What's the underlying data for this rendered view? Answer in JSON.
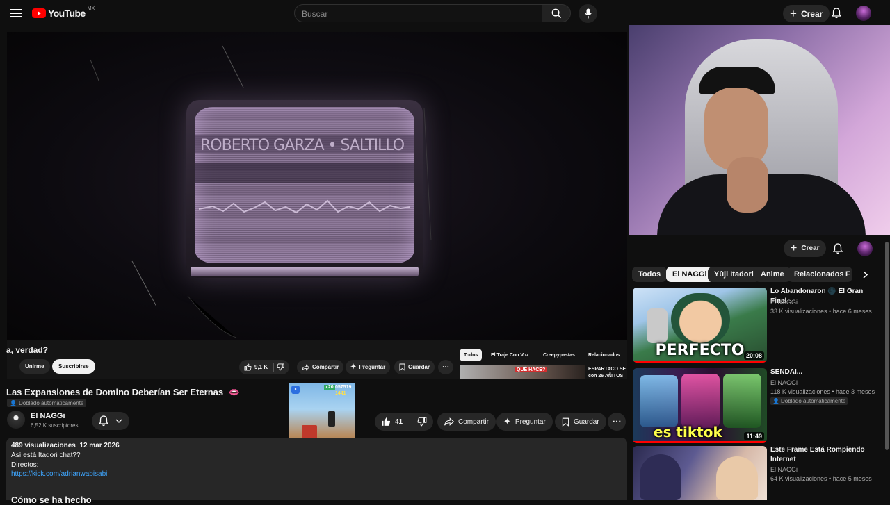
{
  "header": {
    "logo_text": "YouTube",
    "country": "MX",
    "search_placeholder": "Buscar",
    "create_label": "Crear"
  },
  "video_overlay": {
    "partial_title": "a, verdad?",
    "join_label": "Unirme",
    "subscribe_label": "Suscribirse",
    "likes": "9,1 K",
    "share_label": "Compartir",
    "ask_label": "Preguntar",
    "save_label": "Guardar",
    "chips": [
      "Todos",
      "El Traje Con Voz",
      "Creepypastas",
      "Relacionados"
    ],
    "rec_text": "ESPARTACO SE con 26 AÑITOS",
    "rec_thumb_text": "QUÉ HACE?",
    "tv_text": "ROBERTO GARZA • SALTILLO"
  },
  "main": {
    "title": "Las Expansiones de Domino Deberían Ser Eternas",
    "dubbed_label": "Doblado automáticamente",
    "channel": "El NAGGi",
    "subscribers": "6,52 K suscriptores",
    "likes": "41",
    "share_label": "Compartir",
    "ask_label": "Preguntar",
    "save_label": "Guardar",
    "views": "489 visualizaciones",
    "date": "12 mar 2026",
    "desc_line1": "Así está Itadori chat??",
    "desc_line2": "Directos:",
    "desc_link": "https://kick.com/adrianwabisabi",
    "section_heading": "Cómo se ha hecho",
    "game_score": "057519",
    "game_coins": "1441",
    "game_mult": "x20"
  },
  "side": {
    "create_label": "Crear",
    "chips": [
      "Todos",
      "El NAGGi",
      "Yûji Itadori",
      "Anime",
      "Relacionados",
      "F"
    ],
    "videos": [
      {
        "title": "Lo Abandonaron 🌑 El Gran Final",
        "channel": "El NAGGi",
        "meta": "33 K visualizaciones • hace 6 meses",
        "duration": "20:08",
        "thumb_text": "PERFECTO",
        "dubbed": ""
      },
      {
        "title": "SENDAI...",
        "channel": "El NAGGi",
        "meta": "118 K visualizaciones • hace 3 meses",
        "duration": "11:49",
        "thumb_text": "es tiktok",
        "dubbed": "Doblado automáticamente"
      },
      {
        "title": "Este Frame Está Rompiendo Internet",
        "channel": "El NAGGi",
        "meta": "64 K visualizaciones • hace 5 meses",
        "duration": "",
        "thumb_text": "",
        "dubbed": ""
      }
    ]
  },
  "colors": {
    "bg": "#0f0f0f",
    "chip": "#272727",
    "red": "#ff0000",
    "link": "#3ea6ff",
    "tv_glow": "#c9b4d6"
  }
}
